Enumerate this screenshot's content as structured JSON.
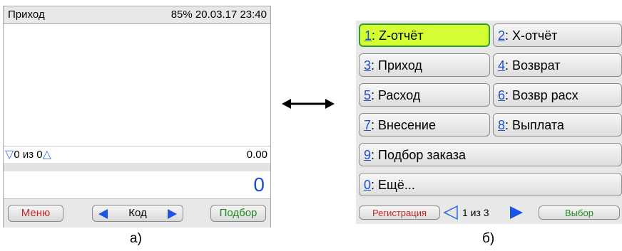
{
  "screen_a": {
    "status": {
      "title": "Приход",
      "battery_datetime": "85% 20.03.17 23:40"
    },
    "counter": {
      "text": "0 из 0",
      "total": "0.00"
    },
    "amount": "0",
    "softkeys": {
      "menu": "Меню",
      "code": "Код",
      "pick": "Подбор"
    },
    "caption": "а)"
  },
  "screen_b": {
    "menu_items": [
      {
        "num": "1",
        "label": ": Z-отчёт"
      },
      {
        "num": "2",
        "label": ": X-отчёт"
      },
      {
        "num": "3",
        "label": ": Приход"
      },
      {
        "num": "4",
        "label": ": Возврат"
      },
      {
        "num": "5",
        "label": ": Расход"
      },
      {
        "num": "6",
        "label": ": Возвр расх"
      },
      {
        "num": "7",
        "label": ": Внесение"
      },
      {
        "num": "8",
        "label": ": Выплата"
      },
      {
        "num": "9",
        "label": ": Подбор заказа"
      },
      {
        "num": "0",
        "label": ": Ещё..."
      }
    ],
    "softkeys": {
      "register": "Регистрация",
      "page": "1 из 3",
      "select": "Выбор"
    },
    "caption": "б)"
  },
  "colors": {
    "accent_blue": "#1a55e6",
    "selection": "#d4ff33",
    "selection_border": "#2f9e2f",
    "red_label": "#c0282a",
    "green_label": "#1f8a1f"
  }
}
